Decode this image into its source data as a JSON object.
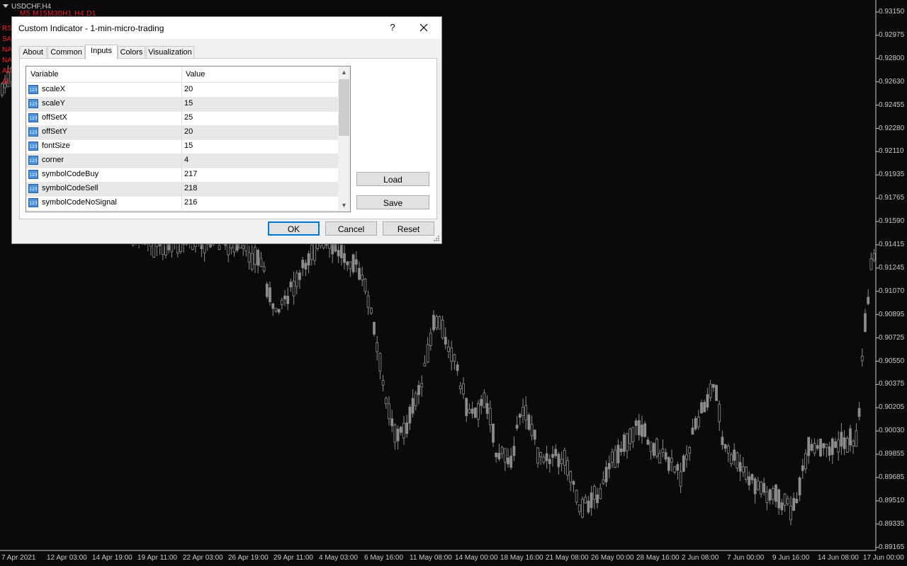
{
  "chart": {
    "symbol": "USDCHF,H4",
    "timeframes": "M5  M15M30H1  H4  D1",
    "side_labels": [
      "RS",
      "SA",
      "NA",
      "NA",
      "AD",
      "ALL"
    ],
    "price_labels": [
      "0.93150",
      "0.92975",
      "0.92800",
      "0.92630",
      "0.92455",
      "0.92280",
      "0.92110",
      "0.91935",
      "0.91765",
      "0.91590",
      "0.91415",
      "0.91245",
      "0.91070",
      "0.90895",
      "0.90725",
      "0.90550",
      "0.90375",
      "0.90205",
      "0.90030",
      "0.89855",
      "0.89685",
      "0.89510",
      "0.89335",
      "0.89165"
    ],
    "date_labels": [
      "7 Apr 2021",
      "12 Apr 03:00",
      "14 Apr 19:00",
      "19 Apr 11:00",
      "22 Apr 03:00",
      "26 Apr 19:00",
      "29 Apr 11:00",
      "4 May 03:00",
      "6 May 16:00",
      "11 May 08:00",
      "14 May 00:00",
      "18 May 16:00",
      "21 May 08:00",
      "26 May 00:00",
      "28 May 16:00",
      "2 Jun 08:00",
      "7 Jun 00:00",
      "9 Jun 16:00",
      "14 Jun 08:00",
      "17 Jun 00:00"
    ],
    "colors": {
      "background": "#0a0a0d",
      "candle": "#8c8c8c",
      "labels": "#c8c8c8",
      "indicator_text": "#ff2020"
    }
  },
  "dialog": {
    "title": "Custom Indicator - 1-min-micro-trading",
    "help_label": "?",
    "close_icon": "close-icon",
    "tabs": [
      "About",
      "Common",
      "Inputs",
      "Colors",
      "Visualization"
    ],
    "active_tab": "Inputs",
    "grid": {
      "headers": {
        "variable": "Variable",
        "value": "Value"
      },
      "rows": [
        {
          "variable": "scaleX",
          "value": "20"
        },
        {
          "variable": "scaleY",
          "value": "15"
        },
        {
          "variable": "offSetX",
          "value": "25"
        },
        {
          "variable": "offSetY",
          "value": "20"
        },
        {
          "variable": "fontSize",
          "value": "15"
        },
        {
          "variable": "corner",
          "value": "4"
        },
        {
          "variable": "symbolCodeBuy",
          "value": "217"
        },
        {
          "variable": "symbolCodeSell",
          "value": "218"
        },
        {
          "variable": "symbolCodeNoSignal",
          "value": "216"
        }
      ],
      "row_icon_text": "123"
    },
    "buttons": {
      "load": "Load",
      "save": "Save",
      "ok": "OK",
      "cancel": "Cancel",
      "reset": "Reset"
    }
  }
}
